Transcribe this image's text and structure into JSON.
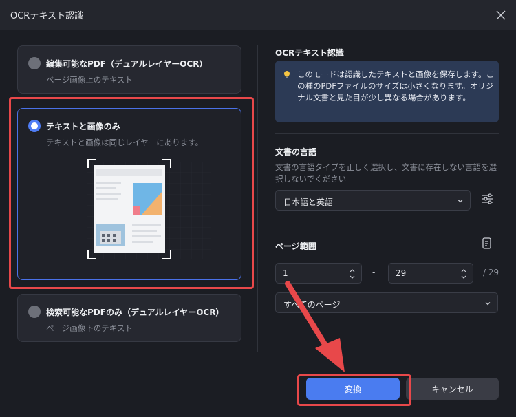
{
  "window": {
    "title": "OCRテキスト認識"
  },
  "options": [
    {
      "title": "編集可能なPDF（デュアルレイヤーOCR）",
      "desc": "ページ画像上のテキスト",
      "selected": false
    },
    {
      "title": "テキストと画像のみ",
      "desc": "テキストと画像は同じレイヤーにあります。",
      "selected": true
    },
    {
      "title": "検索可能なPDFのみ（デュアルレイヤーOCR）",
      "desc": "ページ画像下のテキスト",
      "selected": false
    }
  ],
  "right": {
    "section_title": "OCRテキスト認識",
    "info": "このモードは認識したテキストと画像を保存します。この種のPDFファイルのサイズは小さくなります。オリジナル文書と見た目が少し異なる場合があります。",
    "language": {
      "title": "文書の言語",
      "desc": "文書の言語タイプを正しく選択し、文書に存在しない言語を選択しないでください",
      "selected": "日本語と英語"
    },
    "page_range": {
      "title": "ページ範囲",
      "from": "1",
      "to": "29",
      "separator": "-",
      "total": "/ 29",
      "scope": "すべてのページ"
    }
  },
  "buttons": {
    "convert": "変換",
    "cancel": "キャンセル"
  },
  "colors": {
    "accent": "#4a7cf0",
    "highlight": "#e8484a",
    "background": "#1b1d23"
  }
}
